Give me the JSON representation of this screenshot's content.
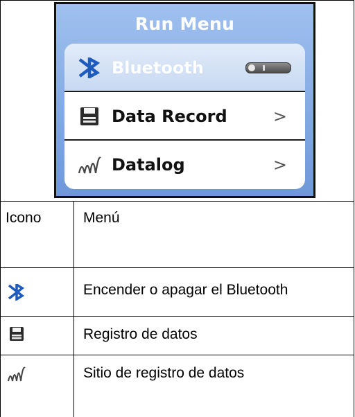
{
  "device": {
    "title": "Run Menu",
    "items": [
      {
        "label": "Bluetooth",
        "icon": "bluetooth-icon",
        "control": "toggle"
      },
      {
        "label": "Data Record",
        "icon": "save-disk-icon",
        "control": "chevron",
        "chevron": ">"
      },
      {
        "label": "Datalog",
        "icon": "datalog-signal-icon",
        "control": "chevron",
        "chevron": ">"
      }
    ]
  },
  "table": {
    "headers": {
      "icon": "Icono",
      "menu": "Menú"
    },
    "rows": [
      {
        "icon": "bluetooth-icon",
        "menu": "Encender o apagar el Bluetooth"
      },
      {
        "icon": "save-disk-icon",
        "menu": "Registro de datos"
      },
      {
        "icon": "datalog-signal-icon",
        "menu": "Sitio de registro de datos"
      }
    ]
  },
  "colors": {
    "screen_blue": "#8eb3e8",
    "bluetooth_blue": "#1e5bbf",
    "text": "#000000"
  }
}
